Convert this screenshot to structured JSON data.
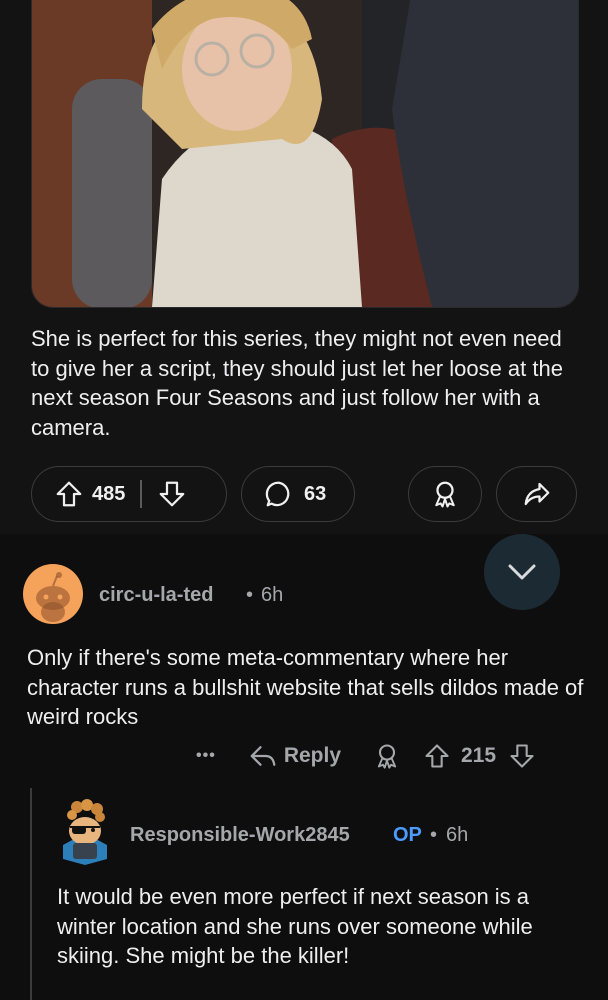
{
  "post": {
    "body": "She is perfect for this series, they might not even need to give her a script, they should just let her loose at the next season Four Seasons and just follow her with a camera.",
    "upvotes": "485",
    "comments": "63"
  },
  "comments": [
    {
      "username": "circ-u-la-ted",
      "time": "6h",
      "body": "Only if there's some meta-commentary where her character runs a bullshit website that sells dildos made of weird rocks",
      "more_label": "•••",
      "reply_label": "Reply",
      "score": "215"
    },
    {
      "username": "Responsible-Work2845",
      "op_badge": "OP",
      "time": "6h",
      "body": "It would be even more perfect if next season is a winter location and she runs over someone while skiing. She might be the killer!"
    }
  ],
  "separator": "•",
  "colors": {
    "accent_op": "#4b9bff",
    "fab_bg": "#1c2b33",
    "avatar": "#f5a25a"
  },
  "icons": [
    "upvote-icon",
    "downvote-icon",
    "comment-icon",
    "award-icon",
    "share-icon",
    "chevron-down-icon",
    "reply-icon",
    "more-icon"
  ]
}
